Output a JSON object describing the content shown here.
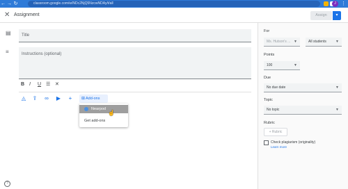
{
  "browser": {
    "url": "classroom.google.com/w/NDc2NjQ5NzcwNDAy/t/all",
    "profile_initial": "J"
  },
  "header": {
    "title": "Assignment",
    "assign_label": "Assign"
  },
  "form": {
    "title_placeholder": "Title",
    "instructions_placeholder": "Instructions (optional)",
    "format": {
      "bold": "B",
      "italic": "I",
      "underline": "U",
      "list": "☰",
      "clear": "✕"
    },
    "addons_label": "Add-ons",
    "addons_menu": [
      {
        "label": "Nearpod"
      },
      {
        "label": "Get add-ons"
      }
    ]
  },
  "side": {
    "for_label": "For",
    "class_value": "Ms. Hutson's ...",
    "students_value": "All students",
    "points_label": "Points",
    "points_value": "100",
    "due_label": "Due",
    "due_value": "No due date",
    "topic_label": "Topic",
    "topic_value": "No topic",
    "rubric_label": "Rubric",
    "rubric_button": "+ Rubric",
    "plagiarism_label": "Check plagiarism (originality)",
    "learn_more": "Learn more"
  },
  "colors": {
    "chrome": "#2f7bd8",
    "accent": "#1a73e8",
    "highlight": "#9e9e9e"
  }
}
